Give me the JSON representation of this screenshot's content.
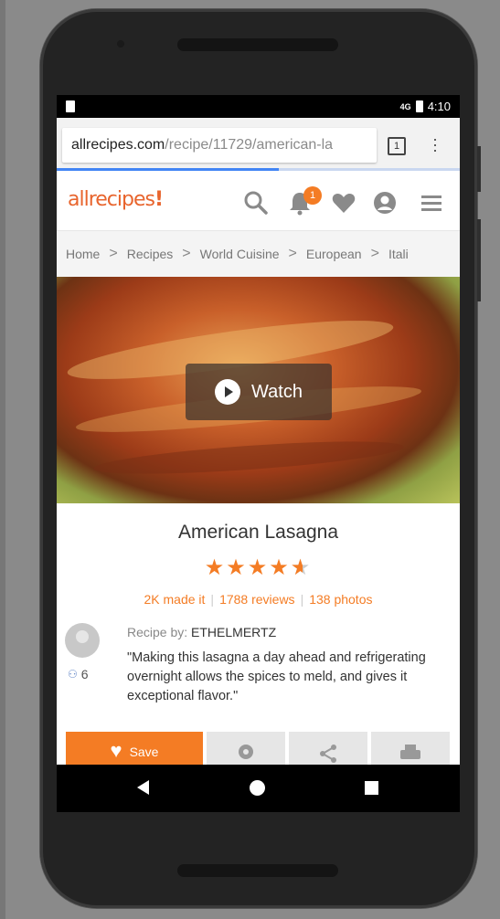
{
  "status_bar": {
    "time": "4:10",
    "signal": "4G"
  },
  "browser": {
    "url_domain": "allrecipes.com",
    "url_path": "/recipe/11729/american-la",
    "tab_count": "1"
  },
  "site": {
    "logo": "allrecipes",
    "notification_count": "1",
    "accent_color": "#f47c24"
  },
  "breadcrumb": [
    {
      "label": "Home"
    },
    {
      "label": "Recipes"
    },
    {
      "label": "World Cuisine"
    },
    {
      "label": "European"
    },
    {
      "label": "Itali"
    }
  ],
  "hero": {
    "watch_label": "Watch"
  },
  "recipe": {
    "title": "American Lasagna",
    "rating": 4.5,
    "made_it": "2K made it",
    "reviews": "1788 reviews",
    "photos": "138 photos",
    "recipe_by_label": "Recipe by:",
    "author": "ETHELMERTZ",
    "followers": "6",
    "quote": "\"Making this lasagna a day ahead and refrigerating overnight allows the spices to meld, and gives it exceptional flavor.\""
  },
  "actions": {
    "save_label": "Save"
  },
  "icons": [
    "search-icon",
    "bell-icon",
    "heart-icon",
    "profile-icon",
    "menu-icon",
    "play-icon",
    "pin-icon",
    "share-icon",
    "print-icon"
  ]
}
